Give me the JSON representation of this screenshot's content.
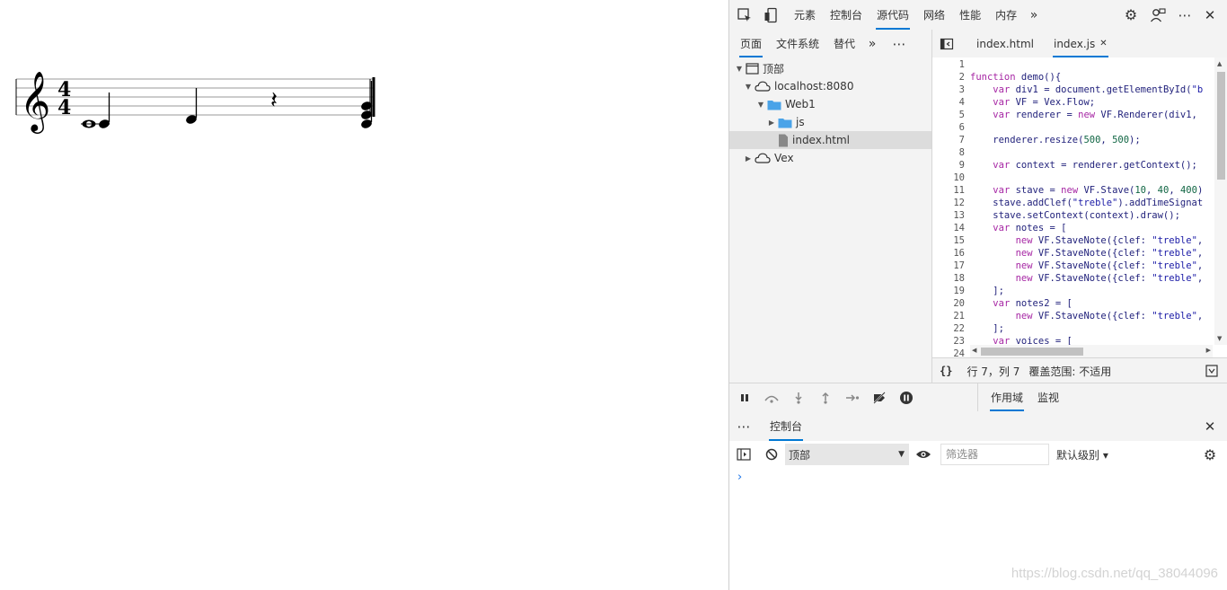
{
  "score": {
    "time_signature": {
      "top": "4",
      "bottom": "4"
    },
    "clef": "treble"
  },
  "devtools": {
    "top_tabs": [
      "元素",
      "控制台",
      "源代码",
      "网络",
      "性能",
      "内存"
    ],
    "active_top_tab": "源代码",
    "navigator_tabs": [
      "页面",
      "文件系统",
      "替代"
    ],
    "active_navigator_tab": "页面",
    "editor_tabs": [
      {
        "label": "index.html",
        "closable": false
      },
      {
        "label": "index.js",
        "closable": true
      }
    ],
    "active_editor_tab": "index.js",
    "tree": [
      {
        "label": "顶部",
        "icon": "frame-icon"
      },
      {
        "label": "localhost:8080",
        "icon": "cloud-icon"
      },
      {
        "label": "Web1",
        "icon": "folder-icon"
      },
      {
        "label": "js",
        "icon": "folder-icon"
      },
      {
        "label": "index.html",
        "icon": "file-icon"
      },
      {
        "label": "Vex",
        "icon": "cloud-icon"
      }
    ],
    "line_numbers": [
      "1",
      "2",
      "3",
      "4",
      "5",
      "6",
      "7",
      "8",
      "9",
      "10",
      "11",
      "12",
      "13",
      "14",
      "15",
      "16",
      "17",
      "18",
      "19",
      "20",
      "21",
      "22",
      "23",
      "24"
    ],
    "code_lines": [
      "",
      "function demo(){",
      "    var div1 = document.getElementById(\"b",
      "    var VF = Vex.Flow;",
      "    var renderer = new VF.Renderer(div1,",
      "",
      "    renderer.resize(500, 500);",
      "",
      "    var context = renderer.getContext();",
      "",
      "    var stave = new VF.Stave(10, 40, 400)",
      "    stave.addClef(\"treble\").addTimeSignat",
      "    stave.setContext(context).draw();",
      "    var notes = [",
      "        new VF.StaveNote({clef: \"treble\",",
      "        new VF.StaveNote({clef: \"treble\",",
      "        new VF.StaveNote({clef: \"treble\",",
      "        new VF.StaveNote({clef: \"treble\",",
      "    ];",
      "    var notes2 = [",
      "        new VF.StaveNote({clef: \"treble\",",
      "    ];",
      "    var voices = [",
      ""
    ],
    "status": {
      "format_label": "{}",
      "position": "行 7，列 7",
      "coverage": "覆盖范围: 不适用"
    },
    "debug_tabs": [
      "作用域",
      "监视"
    ],
    "active_debug_tab": "作用域",
    "drawer": {
      "more_label": "⋯",
      "tab": "控制台"
    },
    "console": {
      "context": "顶部",
      "filter_placeholder": "筛选器",
      "level": "默认级别 ▾",
      "prompt": "›"
    },
    "watermark": "https://blog.csdn.net/qq_38044096"
  },
  "colors": {
    "accent": "#0078d4",
    "folder": "#4aa3e8",
    "prompt": "#1a73e8"
  }
}
